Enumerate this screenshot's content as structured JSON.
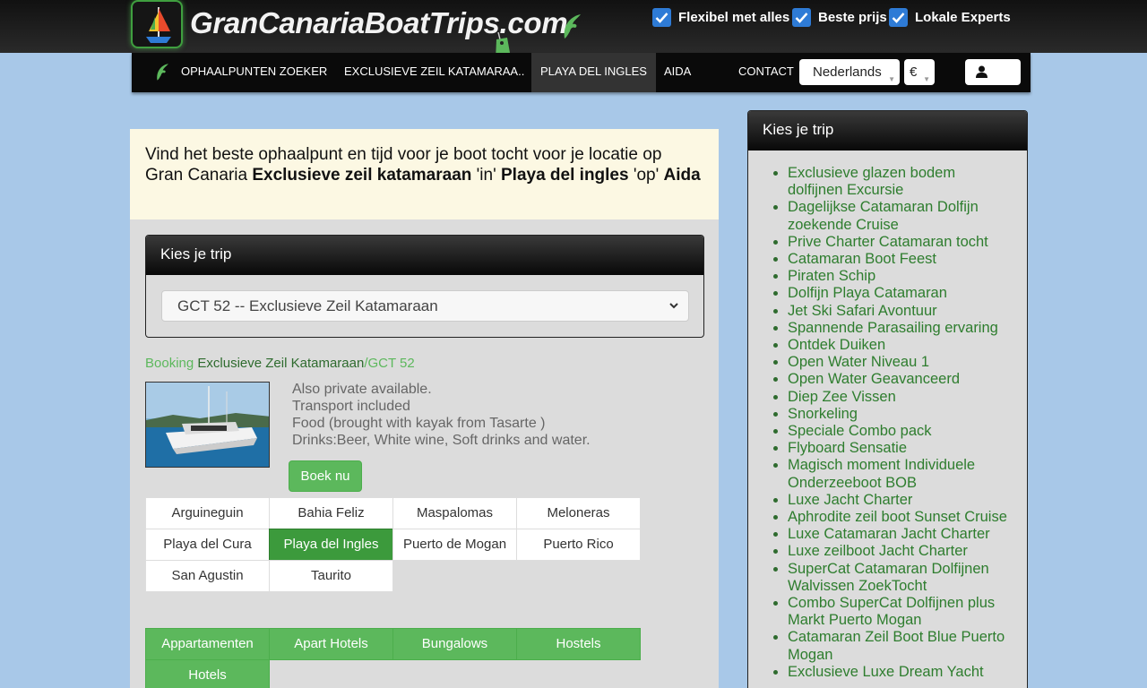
{
  "header": {
    "logo_text": "GranCanariaBoatTrips.com",
    "features": [
      "Flexibel met alles",
      "Beste prijs",
      "Lokale Experts"
    ]
  },
  "nav": {
    "items": [
      "OPHAALPUNTEN ZOEKER",
      "EXCLUSIEVE ZEIL KATAMARAA..",
      "PLAYA DEL INGLES",
      "AIDA"
    ],
    "contact": "CONTACT",
    "language": "Nederlands",
    "currency": "€"
  },
  "alert": {
    "text_1": "Vind het beste ophaalpunt en tijd voor je boot tocht voor je locatie op Gran Canaria",
    "trip": "Exclusieve zeil katamaraan",
    "in": "'in'",
    "location": "Playa del ingles",
    "op": "'op'",
    "hotel": "Aida"
  },
  "trip_panel": {
    "title": "Kies je trip",
    "selected": "GCT 52 -- Exclusieve Zeil Katamaraan"
  },
  "breadcrumb": {
    "booking": "Booking",
    "trip": "Exclusieve Zeil Katamaraan",
    "code": "/GCT 52"
  },
  "description": [
    "Also private available.",
    "Transport included",
    "Food (brought with kayak from Tasarte )",
    "Drinks:Beer, White wine, Soft drinks and water."
  ],
  "book_button": "Boek nu",
  "locations": [
    "Arguineguin",
    "Bahia Feliz",
    "Maspalomas",
    "Meloneras",
    "Playa del Cura",
    "Playa del Ingles",
    "Puerto de Mogan",
    "Puerto Rico",
    "San Agustin",
    "Taurito"
  ],
  "active_location": "Playa del Ingles",
  "accommodation_types": [
    "Appartamenten",
    "Apart Hotels",
    "Bungalows",
    "Hostels",
    "Hotels"
  ],
  "sidebar": {
    "title": "Kies je trip",
    "trips": [
      "Exclusieve glazen bodem dolfijnen Excursie",
      "Dagelijkse Catamaran Dolfijn zoekende Cruise",
      "Prive Charter Catamaran tocht",
      "Catamaran Boot Feest",
      "Piraten Schip",
      "Dolfijn Playa Catamaran",
      "Jet Ski Safari Avontuur",
      "Spannende Parasailing ervaring",
      "Ontdek Duiken",
      "Open Water Niveau 1",
      "Open Water Geavanceerd",
      "Diep Zee Vissen",
      "Snorkeling",
      "Speciale Combo pack",
      "Flyboard Sensatie",
      "Magisch moment Individuele Onderzeeboot BOB",
      "Luxe Jacht Charter",
      "Aphrodite zeil boot Sunset Cruise",
      "Luxe Catamaran Jacht Charter",
      "Luxe zeilboot Jacht Charter",
      "SuperCat Catamaran Dolfijnen Walvissen ZoekTocht",
      "Combo SuperCat Dolfijnen plus Markt Puerto Mogan",
      "Catamaran Zeil Boot Blue Puerto Mogan",
      "Exclusieve Luxe Dream Yacht"
    ]
  },
  "colors": {
    "green": "#5cb85c",
    "active_green": "#3c9a3c",
    "link_green": "#2e6b2e",
    "page_bg": "#a8c8e8",
    "checkbox_blue": "#2e7bd6"
  }
}
